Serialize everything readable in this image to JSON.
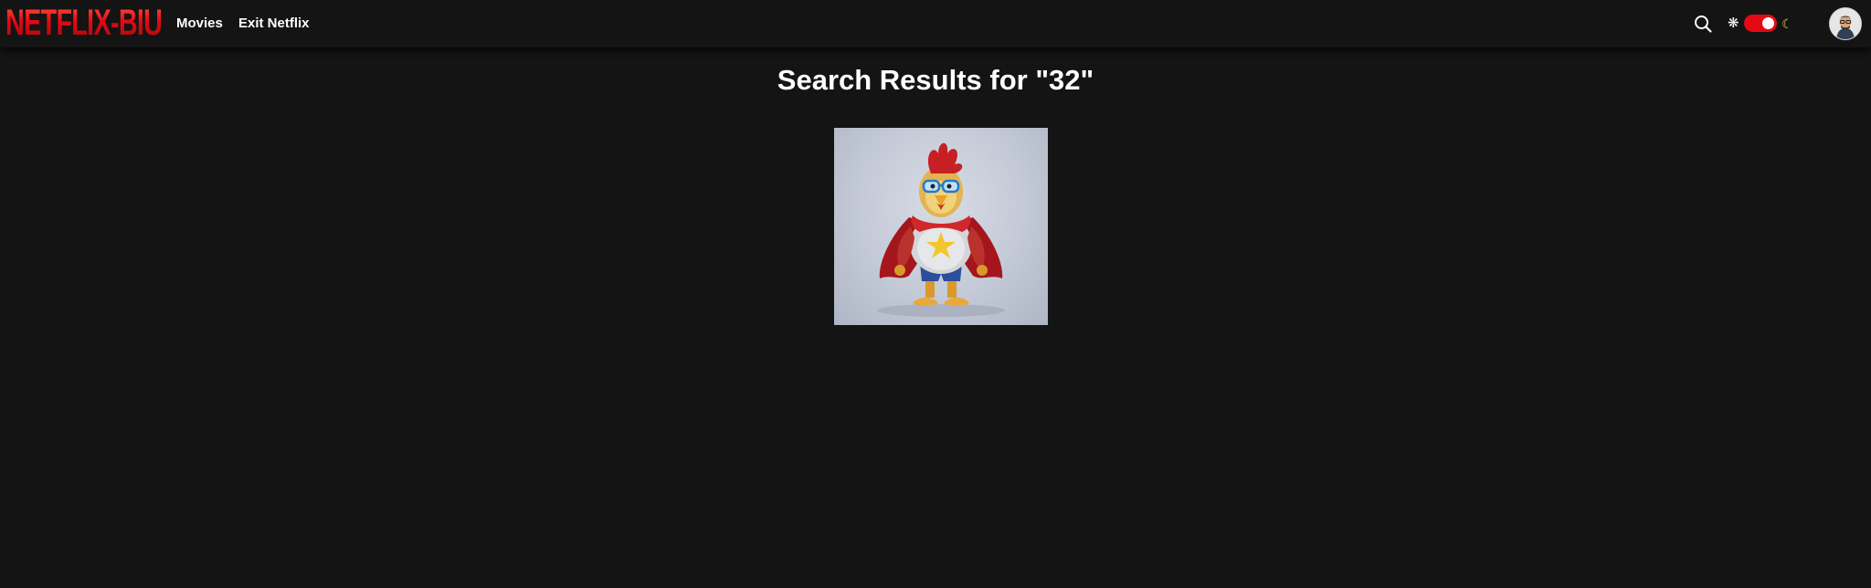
{
  "navbar": {
    "logo_text": "NETFLIX-BIU",
    "links": [
      {
        "label": "Movies"
      },
      {
        "label": "Exit Netflix"
      }
    ],
    "icons": {
      "search": "search-icon",
      "light": "sun-icon",
      "dark": "moon-icon"
    },
    "theme_toggle": {
      "state": "dark-mode-on",
      "accent": "#e50914"
    }
  },
  "search": {
    "heading": "Search Results for \"32\"",
    "results": [
      {
        "image": "cartoon-chicken-superhero-poster"
      }
    ]
  },
  "colors": {
    "background": "#141414",
    "brand": "#e50914",
    "text": "#ffffff"
  }
}
